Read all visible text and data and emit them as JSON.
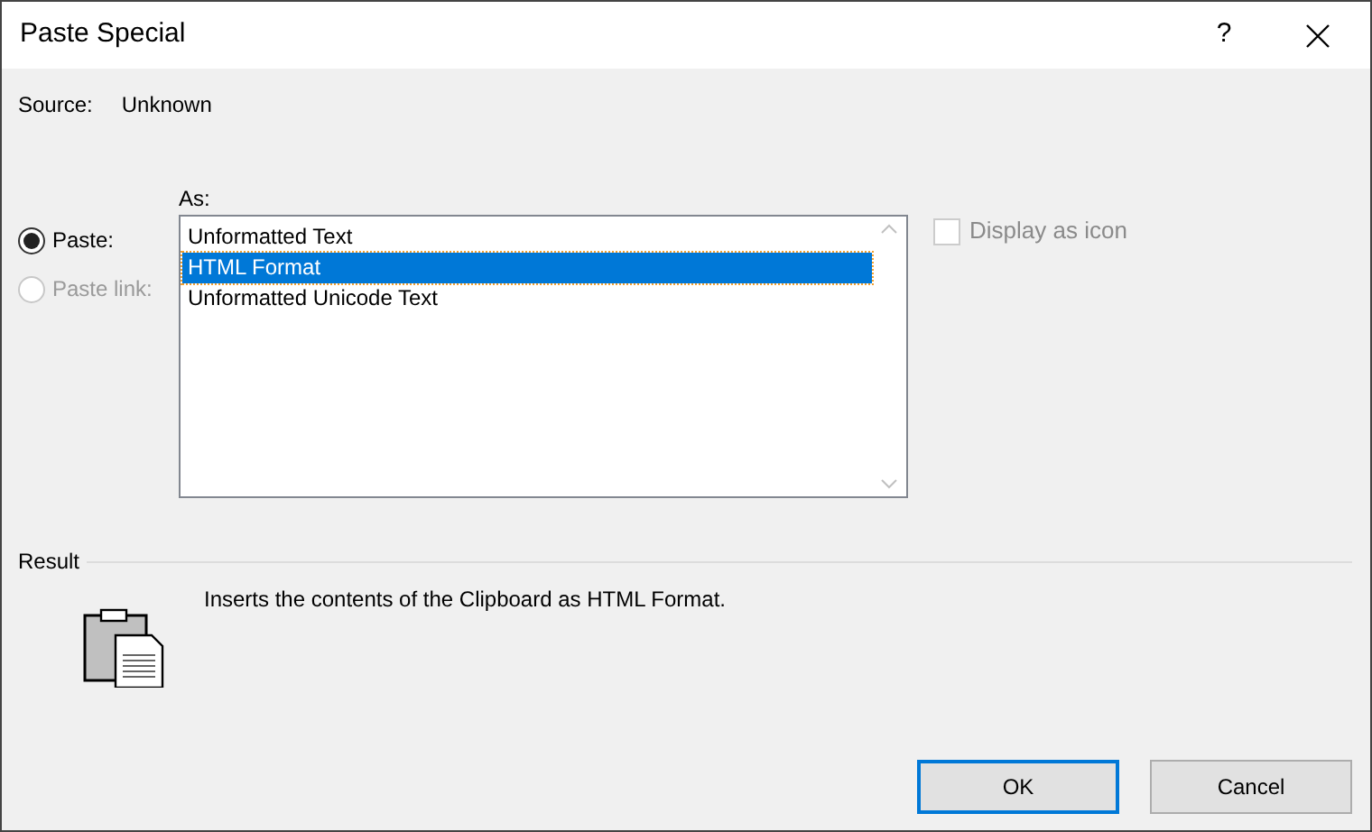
{
  "window": {
    "title": "Paste Special",
    "help": "?"
  },
  "source": {
    "label": "Source:",
    "value": "Unknown"
  },
  "as_label": "As:",
  "options": [
    {
      "label": "Paste:",
      "selected": true,
      "disabled": false
    },
    {
      "label": "Paste link:",
      "selected": false,
      "disabled": true
    }
  ],
  "formats": [
    {
      "label": "Unformatted Text",
      "selected": false
    },
    {
      "label": "HTML Format",
      "selected": true
    },
    {
      "label": "Unformatted Unicode Text",
      "selected": false
    }
  ],
  "display_as_icon": {
    "label": "Display as icon",
    "checked": false,
    "disabled": true
  },
  "result": {
    "title": "Result",
    "text": "Inserts the contents of the Clipboard as HTML Format."
  },
  "buttons": [
    {
      "label": "OK",
      "default": true
    },
    {
      "label": "Cancel",
      "default": false
    }
  ]
}
